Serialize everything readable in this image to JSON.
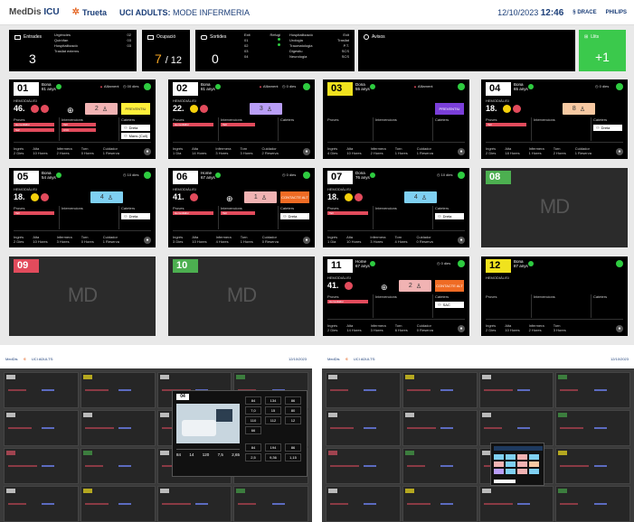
{
  "header": {
    "brand_prefix": "MedDis",
    "brand_suffix": "ICU",
    "hospital": "Trueta",
    "title_prefix": "UCI ADULTS:",
    "title_mode": "MODE INFERMERIA",
    "date": "12/10/2023",
    "time": "12:46",
    "sponsor1": "DRACE",
    "sponsor2": "PHILIPS"
  },
  "summary": {
    "entrades": {
      "label": "Entrades",
      "count": "3",
      "rows": [
        [
          "Urgències",
          "02"
        ],
        [
          "Quiròfan",
          "03"
        ],
        [
          "Hospitalització",
          "03"
        ],
        [
          "Trasllat externs",
          ""
        ]
      ]
    },
    "ocupacio": {
      "label": "Ocupació",
      "value": "7",
      "total": "/ 12"
    },
    "sortides": {
      "label": "Sortides",
      "count": "0",
      "cols": [
        [
          "Exit",
          "01",
          "02",
          "03",
          "04"
        ],
        [
          "Refugi",
          "",
          "",
          "",
          ""
        ]
      ],
      "right": [
        [
          "Hospitalització",
          "Exit"
        ],
        [
          "Urologia",
          "Trasllat"
        ],
        [
          "Traumatologia",
          "P.T."
        ],
        [
          "Digestiu",
          "SCS"
        ],
        [
          "Neurologia",
          "SCS"
        ]
      ]
    },
    "avisos": {
      "label": "Avisos"
    },
    "llits": {
      "label": "Llits",
      "value": "+1"
    }
  },
  "beds": [
    {
      "num": "01",
      "name": "Bona",
      "age": "81 anys",
      "hd": "HEMODIÀLISI",
      "vital": "46.",
      "ab": "Aïllament",
      "tm": "00 dies",
      "pval": "2",
      "flag": "PREVENTIU",
      "sec": [
        "Proves",
        "Intervencions",
        "Cateters"
      ],
      "bars": [
        "Hemodiàlisi",
        "Tall",
        "Saf",
        "CVC"
      ],
      "w1": "Dreta",
      "w2": "Mans (Coll)",
      "foot": [
        "Ingrés",
        "Alta",
        "Infermera",
        "Torn",
        "Cuidador"
      ],
      "footv": [
        "2 Dies",
        "10 Hores",
        "2 Hores",
        "0 Hores",
        "1 Reserva"
      ]
    },
    {
      "num": "02",
      "name": "Bona",
      "age": "81 anys",
      "hd": "HEMODIÀLISI",
      "vital": "22.",
      "ab": "Aïllament",
      "tm": "0 dies",
      "pval": "3",
      "sec": [
        "Proves",
        "Intervencions",
        "Cateters"
      ],
      "bars": [
        "Hemodiàlisi",
        "Tall"
      ],
      "foot": [
        "Ingrés",
        "Alta",
        "Infermera",
        "Torn",
        "Cuidador"
      ],
      "footv": [
        "1 Dia",
        "14 Hores",
        "3 Hores",
        "3 Hores",
        "2 Reserva"
      ]
    },
    {
      "num": "03",
      "name": "Dona",
      "age": "55 anys",
      "ab": "Aïllament",
      "flag": "PREVENTIU",
      "sec": [
        "Proves",
        "Intervencions",
        "Cateters"
      ],
      "foot": [
        "Ingrés",
        "Alta",
        "Infermera",
        "Torn",
        "Cuidador"
      ],
      "footv": [
        "4 Dies",
        "10 Hores",
        "2 Hores",
        "1 Hores",
        "1 Reserva"
      ]
    },
    {
      "num": "04",
      "name": "Bona",
      "age": "65 anys",
      "hd": "HEMODIÀLISI",
      "vital": "18.",
      "tm": "0 dies",
      "pval": "8",
      "sec": [
        "Proves",
        "Intervencions",
        "Cateters"
      ],
      "bars": [
        "Tall"
      ],
      "w1": "Dreta",
      "foot": [
        "Ingrés",
        "Alta",
        "Infermera",
        "Torn",
        "Cuidador"
      ],
      "footv": [
        "2 Dies",
        "18 Hores",
        "1 Hores",
        "2 Hores",
        "1 Reserva"
      ]
    },
    {
      "num": "05",
      "name": "Bona",
      "age": "54 anys",
      "hd": "HEMODIÀLISI",
      "vital": "18.",
      "tm": "10 dies",
      "pval": "4",
      "sec": [
        "Proves",
        "Intervencions",
        "Cateters"
      ],
      "bars": [
        "Tall"
      ],
      "w1": "Dreta",
      "foot": [
        "Ingrés",
        "Alta",
        "Infermera",
        "Torn",
        "Cuidador"
      ],
      "footv": [
        "2 Dies",
        "10 Hores",
        "3 Hores",
        "0 Hores",
        "1 Reserva"
      ]
    },
    {
      "num": "06",
      "name": "Home",
      "age": "67 anys",
      "hd": "HEMODIÀLISI",
      "vital": "41.",
      "tm": "0 dies",
      "pval": "1",
      "flag": "CONTACTE ALT",
      "sec": [
        "Proves",
        "Intervencions",
        "Cateters"
      ],
      "bars": [
        "Hemodiàlisi",
        "Tall"
      ],
      "w1": "Dreta",
      "foot": [
        "Ingrés",
        "Alta",
        "Infermera",
        "Torn",
        "Cuidador"
      ],
      "footv": [
        "3 Dies",
        "10 Hores",
        "4 Hores",
        "1 Hores",
        "0 Reserva"
      ]
    },
    {
      "num": "07",
      "name": "Dona",
      "age": "76 anys",
      "hd": "HEMODIÀLISI",
      "vital": "18.",
      "tm": "10 dies",
      "pval": "4",
      "sec": [
        "Proves",
        "Intervencions",
        "Cateters"
      ],
      "bars": [
        "Tall"
      ],
      "w1": "Dreta",
      "foot": [
        "Ingrés",
        "Alta",
        "Infermera",
        "Torn",
        "Cuidador"
      ],
      "footv": [
        "1 Dia",
        "10 Hores",
        "3 Hores",
        "4 Hores",
        "0 Reserva"
      ]
    },
    {
      "num": "08",
      "empty": true,
      "md": "MD"
    },
    {
      "num": "09",
      "empty": true,
      "md": "MD"
    },
    {
      "num": "10",
      "empty": true,
      "md": "MD"
    },
    {
      "num": "11",
      "name": "Home",
      "age": "67 anys",
      "hd": "HEMODIÀLISI",
      "vital": "41.",
      "tm": "0 dies",
      "pval": "2",
      "flag": "CONTACTE ALT",
      "sec": [
        "Proves",
        "Intervencions",
        "Cateters"
      ],
      "bars": [
        "Hemodiàlisi"
      ],
      "w1": "SAC",
      "foot": [
        "Ingrés",
        "Alta",
        "Infermera",
        "Torn",
        "Cuidador"
      ],
      "footv": [
        "2 Dies",
        "14 Hores",
        "3 Hores",
        "6 Hores",
        "0 Reserva"
      ]
    },
    {
      "num": "12",
      "name": "Bona",
      "age": "87 anys",
      "hd": "HEMODIÀLISI",
      "sec": [
        "Proves",
        "Intervencions",
        "Cateters"
      ],
      "foot": [
        "Ingrés",
        "Alta",
        "Infermera",
        "Torn"
      ],
      "footv": [
        "2 Dies",
        "10 Hores",
        "2 Hores",
        "3 Hores"
      ]
    }
  ],
  "popup": {
    "bed": "04",
    "vitals": [
      "84",
      "134",
      "86",
      "7,0",
      "15",
      "80",
      "110",
      "112",
      "12",
      "66"
    ],
    "vitals2": [
      "84",
      "194",
      "86",
      "2,5",
      "9,36",
      "1,15",
      "982",
      "389",
      "50",
      "14",
      "18/6/23"
    ],
    "vals": [
      "84",
      "14",
      "120",
      "7,5",
      "2,65"
    ]
  }
}
